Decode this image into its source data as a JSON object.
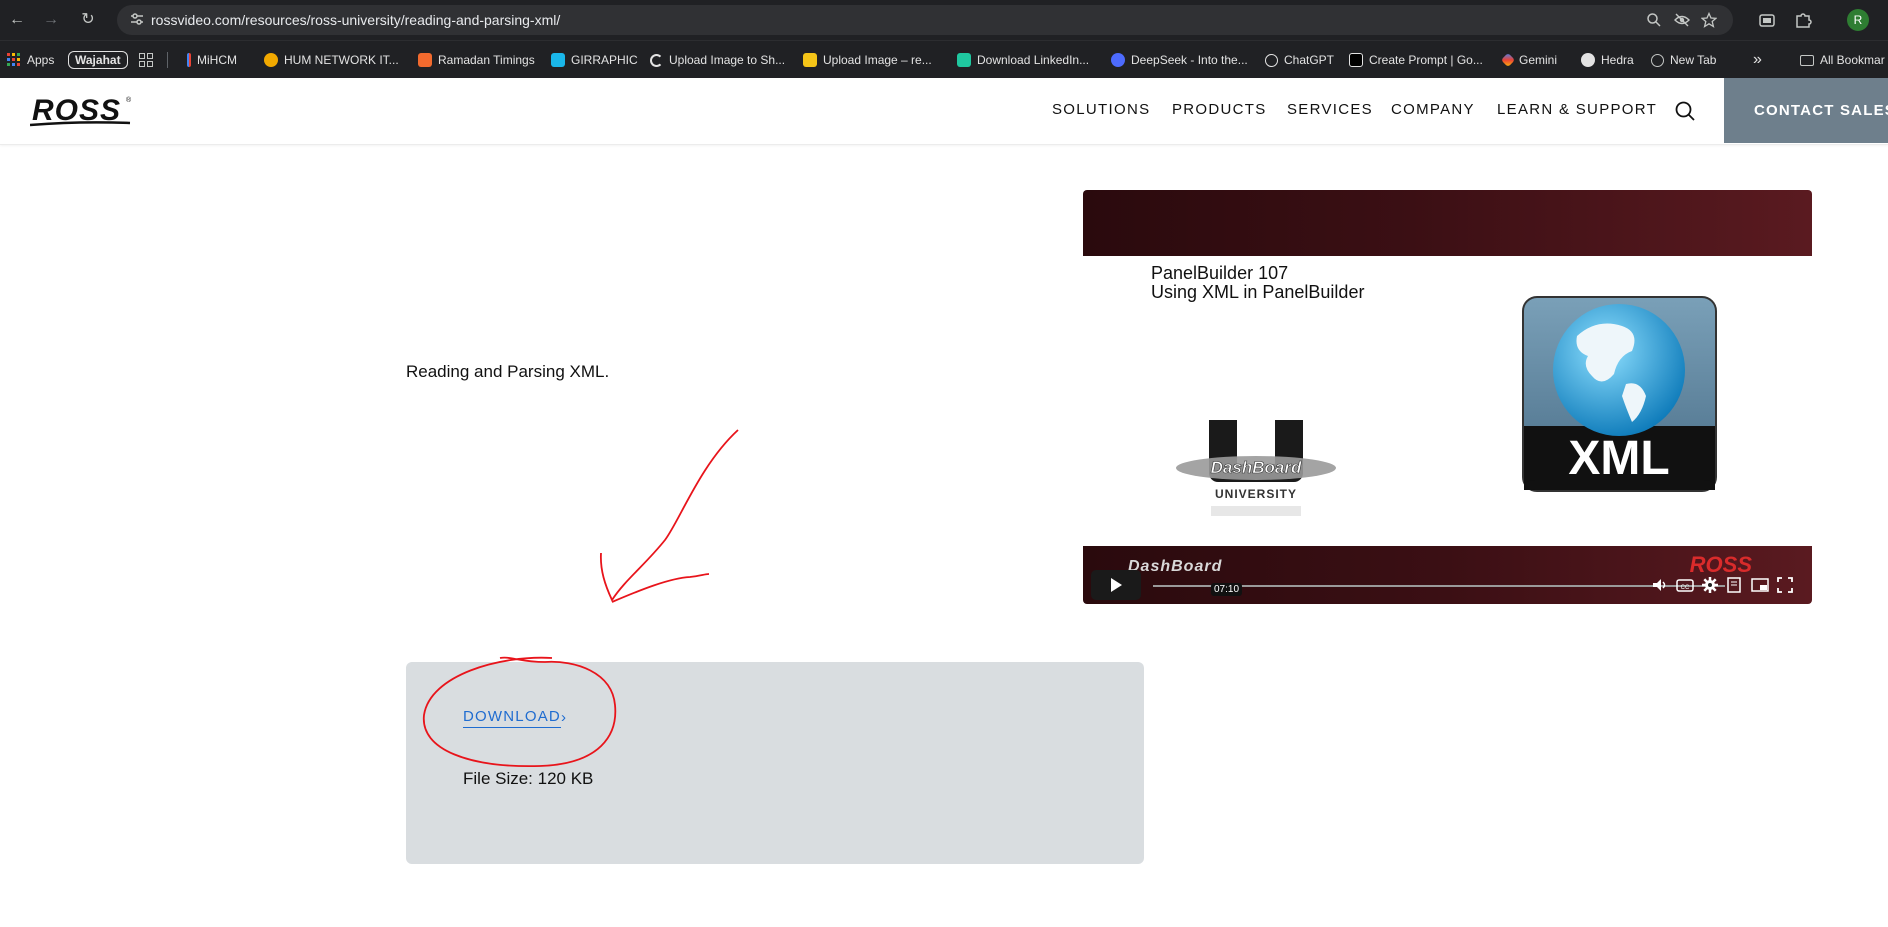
{
  "browser": {
    "url": "rossvideo.com/resources/ross-university/reading-and-parsing-xml/",
    "profile_initial": "R",
    "bookmarks": [
      {
        "label": "Apps",
        "icon": "apps-grid-icon"
      },
      {
        "label": "Wajahat",
        "icon": "none"
      },
      {
        "label": "",
        "icon": "tab-groups-icon"
      },
      {
        "label": "MiHCM",
        "icon": "mihcm-icon"
      },
      {
        "label": "HUM NETWORK IT...",
        "icon": "hum-icon"
      },
      {
        "label": "Ramadan Timings",
        "icon": "ramadan-icon"
      },
      {
        "label": "GIRRAPHIC",
        "icon": "vimeo-icon"
      },
      {
        "label": "Upload Image to Sh...",
        "icon": "c-icon"
      },
      {
        "label": "Upload Image – re...",
        "icon": "upload-icon"
      },
      {
        "label": "Download LinkedIn...",
        "icon": "shield-icon"
      },
      {
        "label": "DeepSeek - Into the...",
        "icon": "deepseek-icon"
      },
      {
        "label": "ChatGPT",
        "icon": "chatgpt-icon"
      },
      {
        "label": "Create Prompt | Go...",
        "icon": "prompt-icon"
      },
      {
        "label": "Gemini",
        "icon": "gemini-icon"
      },
      {
        "label": "Hedra",
        "icon": "hedra-icon"
      },
      {
        "label": "New Tab",
        "icon": "globe-icon"
      }
    ],
    "all_bookmarks_label": "All Bookmar"
  },
  "site": {
    "logo_text": "ROSS",
    "nav": [
      "SOLUTIONS",
      "PRODUCTS",
      "SERVICES",
      "COMPANY",
      "LEARN & SUPPORT"
    ],
    "contact_label": "CONTACT SALES"
  },
  "content": {
    "description": "Reading and Parsing XML.",
    "video": {
      "title_line1": "PanelBuilder 107",
      "title_line2": "Using XML in PanelBuilder",
      "xml_label": "XML",
      "dashboard_text": "DashBoard",
      "university_text": "UNIVERSITY",
      "brand_text": "DashBoard",
      "ross_text": "ROSS",
      "time": "07:10"
    },
    "download_label": "DOWNLOAD",
    "file_size": "File Size: 120 KB"
  },
  "colors": {
    "annotation": "#e8141b",
    "link": "#1f6cd0",
    "contact_bg": "#6e7f8c",
    "download_box": "#d9dde0"
  }
}
